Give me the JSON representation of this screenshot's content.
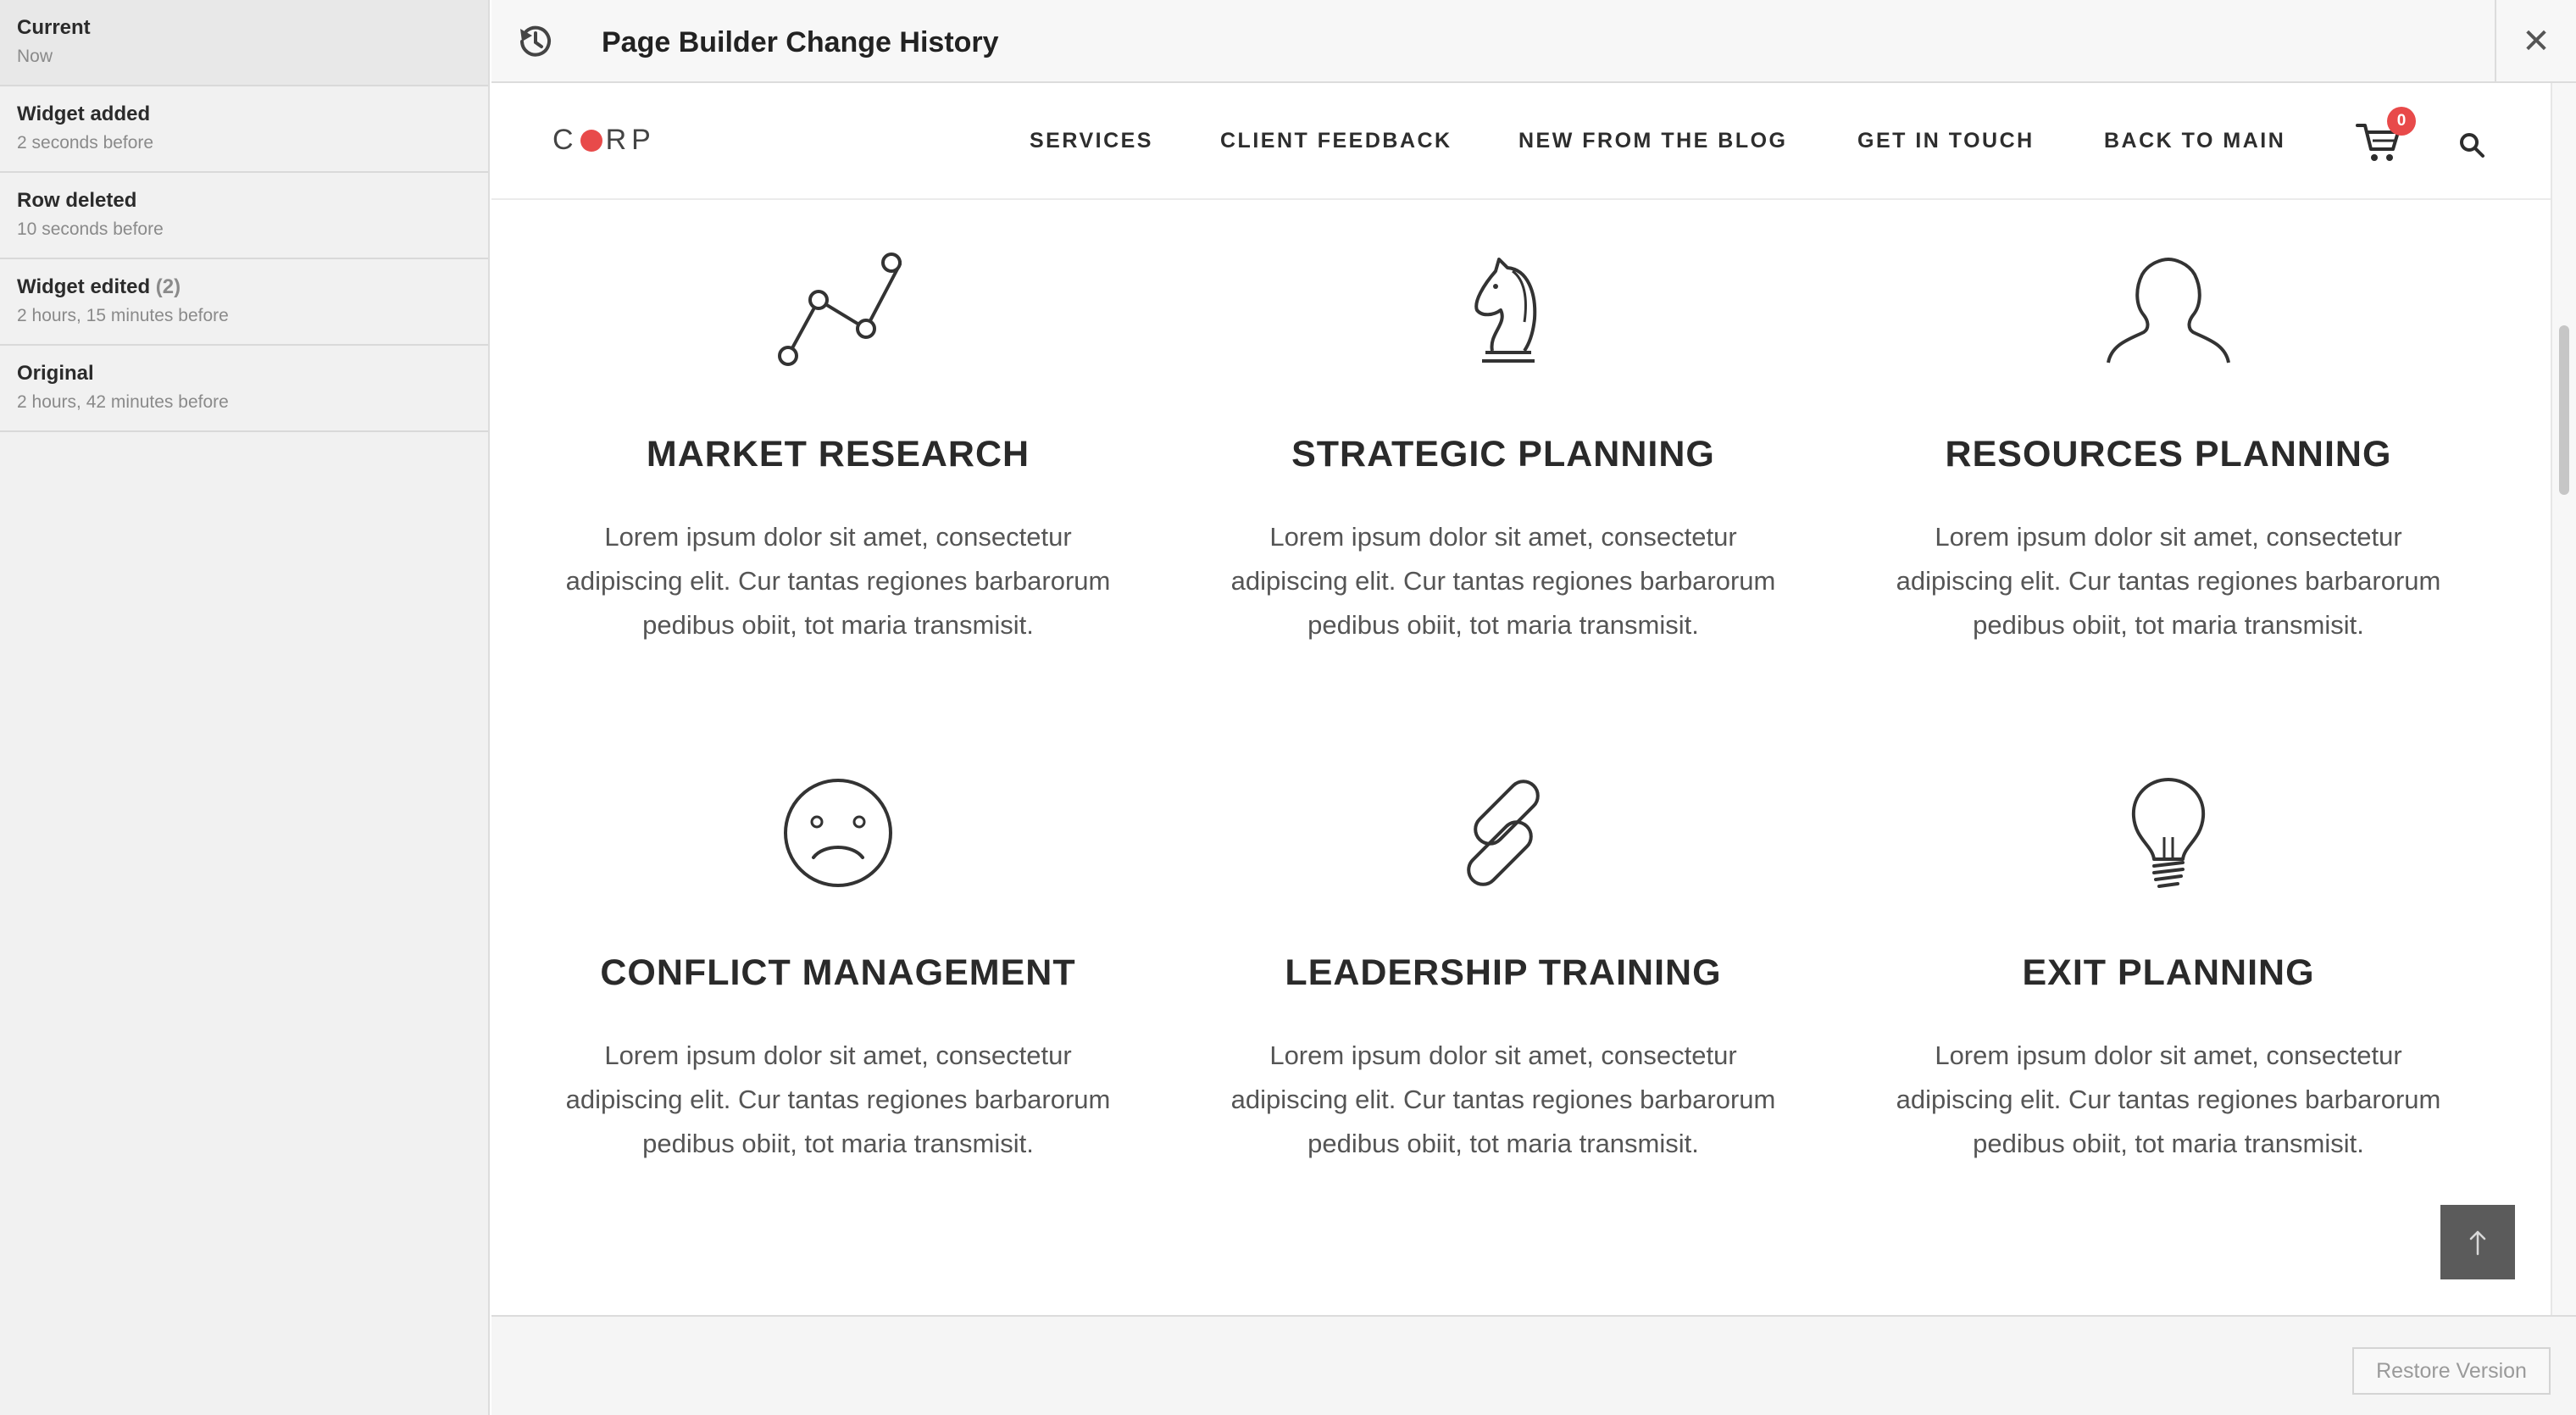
{
  "sidebar": {
    "items": [
      {
        "title": "Current",
        "count": "",
        "time": "Now",
        "active": true
      },
      {
        "title": "Widget added",
        "count": "",
        "time": "2 seconds before",
        "active": false
      },
      {
        "title": "Row deleted",
        "count": "",
        "time": "10 seconds before",
        "active": false
      },
      {
        "title": "Widget edited",
        "count": "(2)",
        "time": "2 hours, 15 minutes before",
        "active": false
      },
      {
        "title": "Original",
        "count": "",
        "time": "2 hours, 42 minutes before",
        "active": false
      }
    ]
  },
  "header": {
    "title": "Page Builder Change History",
    "history_icon": "history-icon",
    "close_label": "✕"
  },
  "site": {
    "logo_left": "C",
    "logo_right": "RP",
    "logo_dot_color": "#e84a4a",
    "nav": [
      "SERVICES",
      "CLIENT FEEDBACK",
      "NEW FROM THE BLOG",
      "GET IN TOUCH",
      "BACK TO MAIN"
    ],
    "cart_count": "0",
    "cart_badge_color": "#e84a4a"
  },
  "cards": [
    {
      "icon": "line-chart-icon",
      "title": "MARKET RESEARCH",
      "body": "Lorem ipsum dolor sit amet, consectetur adipiscing elit. Cur tantas regiones barbarorum pedibus obiit, tot maria transmisit."
    },
    {
      "icon": "chess-knight-icon",
      "title": "STRATEGIC PLANNING",
      "body": "Lorem ipsum dolor sit amet, consectetur adipiscing elit. Cur tantas regiones barbarorum pedibus obiit, tot maria transmisit."
    },
    {
      "icon": "user-silhouette-icon",
      "title": "RESOURCES PLANNING",
      "body": "Lorem ipsum dolor sit amet, consectetur adipiscing elit. Cur tantas regiones barbarorum pedibus obiit, tot maria transmisit."
    },
    {
      "icon": "sad-face-icon",
      "title": "CONFLICT MANAGEMENT",
      "body": "Lorem ipsum dolor sit amet, consectetur adipiscing elit. Cur tantas regiones barbarorum pedibus obiit, tot maria transmisit."
    },
    {
      "icon": "chain-link-icon",
      "title": "LEADERSHIP TRAINING",
      "body": "Lorem ipsum dolor sit amet, consectetur adipiscing elit. Cur tantas regiones barbarorum pedibus obiit, tot maria transmisit."
    },
    {
      "icon": "light-bulb-icon",
      "title": "EXIT PLANNING",
      "body": "Lorem ipsum dolor sit amet, consectetur adipiscing elit. Cur tantas regiones barbarorum pedibus obiit, tot maria transmisit."
    }
  ],
  "footer": {
    "restore_label": "Restore Version"
  },
  "colors": {
    "accent_red": "#e84a4a",
    "back_to_top_bg": "#5b5b5b"
  }
}
